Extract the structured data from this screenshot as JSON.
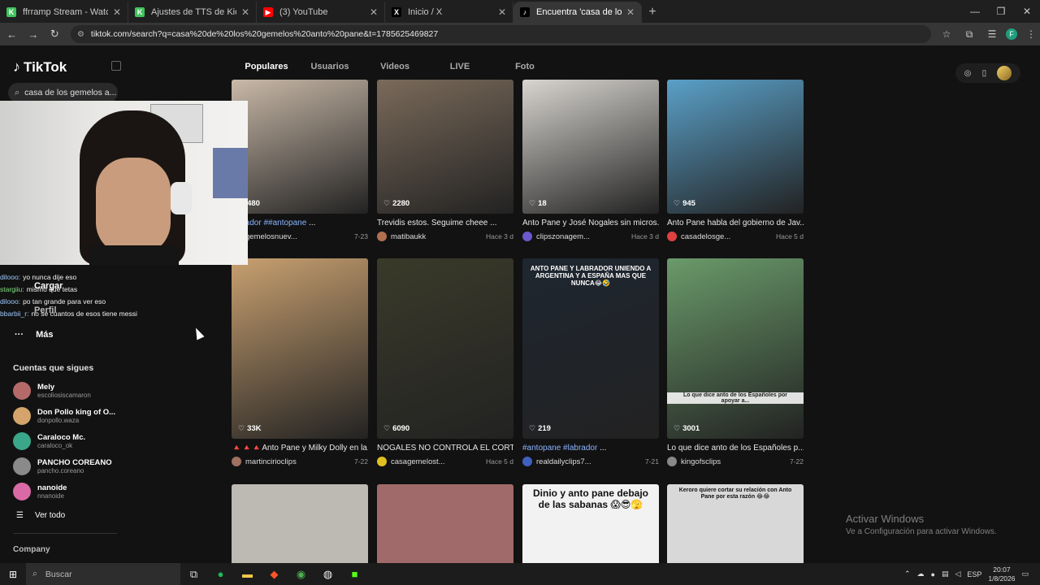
{
  "browser": {
    "tabs": [
      {
        "title": "ffrramp Stream - Watch Live on",
        "favicon_color": "#3fc35a",
        "favicon_glyph": "K",
        "active": false
      },
      {
        "title": "Ajustes de TTS de KickBot",
        "favicon_color": "#3fc35a",
        "favicon_glyph": "K",
        "active": false
      },
      {
        "title": "(3) YouTube",
        "favicon_color": "#ff0000",
        "favicon_glyph": "▶",
        "active": false
      },
      {
        "title": "Inicio / X",
        "favicon_color": "#000000",
        "favicon_glyph": "X",
        "active": false
      },
      {
        "title": "Encuentra 'casa de los gemelos",
        "favicon_color": "#000000",
        "favicon_glyph": "♪",
        "active": true
      }
    ],
    "url": "tiktok.com/search?q=casa%20de%20los%20gemelos%20anto%20pane&t=1785625469827",
    "profile_initial": "F"
  },
  "tiktok": {
    "logo": "TikTok",
    "search_text": "casa de los gemelos a...",
    "tabs": [
      "Populares",
      "Usuarios",
      "Videos",
      "LIVE",
      "Foto"
    ],
    "active_tab": "Populares",
    "nav": {
      "cargar": "Cargar",
      "perfil": "Perfil",
      "mas": "Más"
    },
    "following_title": "Cuentas que sigues",
    "following": [
      {
        "name": "Mely",
        "handle": "escoliosiscamaron",
        "color": "#b56a6a"
      },
      {
        "name": "Don Pollo king of O...",
        "handle": "donpollo.waza",
        "color": "#d4a46a"
      },
      {
        "name": "Caraloco Mc.",
        "handle": "caraloco_ok",
        "color": "#3aa68a"
      },
      {
        "name": "PANCHO COREANO",
        "handle": "pancho.coreano",
        "color": "#8a8a8a"
      },
      {
        "name": "nanoide",
        "handle": "nnanoide",
        "color": "#d96aa6"
      }
    ],
    "ver_todo": "Ver todo",
    "company": "Company"
  },
  "chat": [
    {
      "user": "dilooo:",
      "msg": "yo nunca dije eso",
      "green": false
    },
    {
      "user": "stargiiu:",
      "msg": "mismo que tetas",
      "green": true
    },
    {
      "user": "dilooo:",
      "msg": "po tan grande para ver eso",
      "green": false
    },
    {
      "user": "bbarbii_r:",
      "msg": "no se cuantos de esos tiene messi",
      "green": false
    }
  ],
  "videos": [
    {
      "likes": "480",
      "title_pre": "",
      "title_hl": "labrador ##antopane",
      "title_post": " ...",
      "channel": "gemelosnuev...",
      "date": "7-23",
      "bg": "#c9b9a8",
      "avatar": "#777"
    },
    {
      "likes": "2280",
      "title_pre": "Trevidis estos. Seguime cheee ...",
      "title_hl": "",
      "title_post": "",
      "channel": "matibaukk",
      "date": "Hace 3 d",
      "bg": "#7a6a5a",
      "avatar": "#b07050"
    },
    {
      "likes": "18",
      "title_pre": "Anto Pane y José Nogales sin micros...",
      "title_hl": "",
      "title_post": "",
      "channel": "clipszonagem...",
      "date": "Hace 3 d",
      "bg": "#d8d5d0",
      "avatar": "#6a5acd"
    },
    {
      "likes": "945",
      "title_pre": "Anto Pane habla del gobierno de Jav...",
      "title_hl": "",
      "title_post": "",
      "channel": "casadelosge...",
      "date": "Hace 5 d",
      "bg": "#5aa0c8",
      "avatar": "#e04040"
    },
    {
      "likes": "33K",
      "title_pre": "🔺🔺🔺Anto Pane y Milky Dolly en la...",
      "title_hl": "",
      "title_post": "",
      "channel": "martincirioclips",
      "date": "7-22",
      "bg": "#c8a070",
      "avatar": "#a07060"
    },
    {
      "likes": "6090",
      "title_pre": "NOGALES NO CONTROLA EL CORTI...",
      "title_hl": "",
      "title_post": "",
      "channel": "casagemelost...",
      "date": "Hace 5 d",
      "bg": "#3a3a2a",
      "avatar": "#e0c020"
    },
    {
      "likes": "219",
      "title_pre": "",
      "title_hl": "#antopane #labrador",
      "title_post": " ...",
      "channel": "realdailyclips7...",
      "date": "7-21",
      "bg": "#1e2630",
      "avatar": "#4060c0"
    },
    {
      "likes": "3001",
      "title_pre": "Lo que dice anto de los Españoles p...",
      "title_hl": "",
      "title_post": "",
      "channel": "kingofsclips",
      "date": "7-22",
      "bg": "#6a9a6a",
      "avatar": "#888"
    }
  ],
  "overlays": {
    "v7_text": "ANTO PANE Y LABRADOR UNIENDO A ARGENTINA Y A ESPAÑA MAS QUE NUNCA😂🤣",
    "v8_text": "Lo que dice anto de los Españoles por apoyar a...",
    "v11_text": "Dinio y anto pane debajo de las sabanas 😱😎🫣",
    "v12_text": "Keroro quiere cortar su relación con Anto Pane por esta razón 😂😂"
  },
  "watermark": {
    "line1": "Activar Windows",
    "line2": "Ve a Configuración para activar Windows."
  },
  "taskbar": {
    "search": "Buscar",
    "lang": "ESP",
    "time": "20:07",
    "date": "1/8/2026"
  }
}
